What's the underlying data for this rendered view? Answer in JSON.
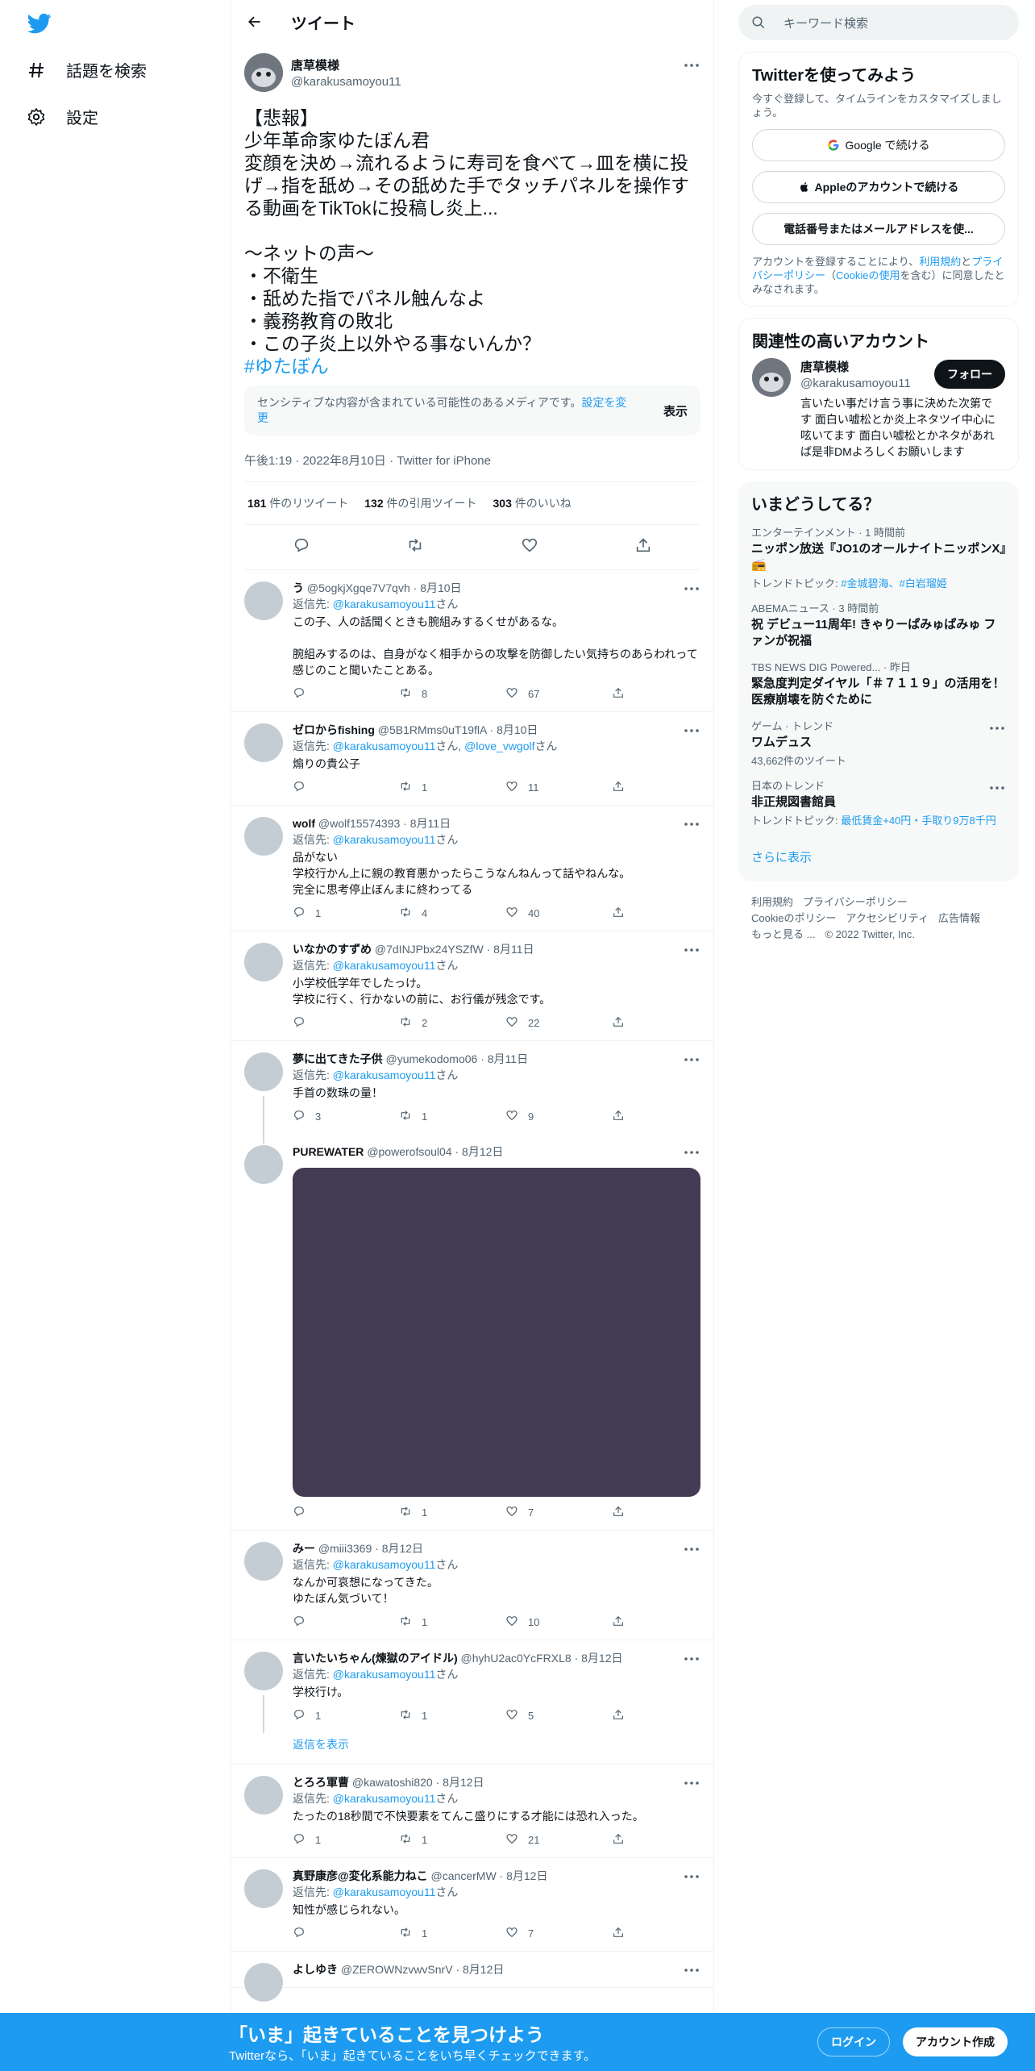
{
  "nav": {
    "explore_label": "話題を検索",
    "settings_label": "設定"
  },
  "header": {
    "title": "ツイート"
  },
  "main_tweet": {
    "name": "唐草模様",
    "handle": "@karakusamoyou11",
    "text": "【悲報】\n少年革命家ゆたぼん君\n変顔を決め→流れるように寿司を食べて→皿を横に投げ→指を舐め→その舐めた手でタッチパネルを操作する動画をTikTokに投稿し炎上...\n\n〜ネットの声〜\n・不衛生\n・舐めた指でパネル触んなよ\n・義務教育の敗北\n・この子炎上以外やる事ないんか？",
    "hashtag": "#ゆたぼん",
    "sensitive_msg": "センシティブな内容が含まれている可能性のあるメディアです。",
    "sensitive_link": "設定を変更",
    "sensitive_show": "表示",
    "meta": "午後1:19 · 2022年8月10日 · Twitter for iPhone",
    "retweets": "181",
    "retweets_label": "件のリツイート",
    "quotes": "132",
    "quotes_label": "件の引用ツイート",
    "likes": "303",
    "likes_label": "件のいいね"
  },
  "reply_prefix": "返信先: ",
  "san": "さん",
  "replies": [
    {
      "name": "う",
      "handle": "@5ogkjXgqe7V7qvh",
      "date": "8月10日",
      "to": "@karakusamoyou11",
      "text": "この子、人の話聞くときも腕組みするくせがあるな。\n\n腕組みするのは、自身がなく相手からの攻撃を防御したい気持ちのあらわれって感じのこと聞いたことある。",
      "replies": "",
      "retweets": "8",
      "likes": "67"
    },
    {
      "name": "ゼロからfishing",
      "handle": "@5B1RMms0uT19flA",
      "date": "8月10日",
      "to": "@karakusamoyou11",
      "to2": "@love_vwgolf",
      "text": "煽りの貴公子",
      "replies": "",
      "retweets": "1",
      "likes": "11"
    },
    {
      "name": "wolf",
      "handle": "@wolf15574393",
      "date": "8月11日",
      "to": "@karakusamoyou11",
      "text": "品がない\n学校行かん上に親の教育悪かったらこうなんねんって話やねんな。\n完全に思考停止ぼんまに終わってる",
      "replies": "1",
      "retweets": "4",
      "likes": "40"
    },
    {
      "name": "いなかのすずめ",
      "handle": "@7dINJPbx24YSZfW",
      "date": "8月11日",
      "to": "@karakusamoyou11",
      "text": "小学校低学年でしたっけ。\n学校に行く、行かないの前に、お行儀が残念です。",
      "replies": "",
      "retweets": "2",
      "likes": "22"
    },
    {
      "name": "夢に出てきた子供",
      "handle": "@yumekodomo06",
      "date": "8月11日",
      "to": "@karakusamoyou11",
      "text": "手首の数珠の量！",
      "replies": "3",
      "retweets": "1",
      "likes": "9"
    },
    {
      "name": "PUREWATER",
      "handle": "@powerofsoul04",
      "date": "8月12日",
      "replies": "",
      "retweets": "1",
      "likes": "7"
    },
    {
      "name": "みー",
      "handle": "@miii3369",
      "date": "8月12日",
      "to": "@karakusamoyou11",
      "text": "なんか可哀想になってきた。\nゆたぼん気づいて！",
      "replies": "",
      "retweets": "1",
      "likes": "10"
    },
    {
      "name": "言いたいちゃん(煉獄のアイドル)",
      "handle": "@hyhU2ac0YcFRXL8",
      "date": "8月12日",
      "to": "@karakusamoyou11",
      "text": "学校行け。",
      "replies": "1",
      "retweets": "1",
      "likes": "5"
    },
    {
      "name": "とろろ軍曹",
      "handle": "@kawatoshi820",
      "date": "8月12日",
      "to": "@karakusamoyou11",
      "text": "たったの18秒間で不快要素をてんこ盛りにする才能には恐れ入った。",
      "replies": "1",
      "retweets": "1",
      "likes": "21"
    },
    {
      "name": "真野康彦@変化系能力ねこ",
      "handle": "@cancerMW",
      "date": "8月12日",
      "to": "@karakusamoyou11",
      "text": "知性が感じられない。",
      "replies": "",
      "retweets": "1",
      "likes": "7"
    },
    {
      "name": "よしゆき",
      "handle": "@ZEROWNzvwvSnrV",
      "date": "8月12日"
    }
  ],
  "show_replies": "返信を表示",
  "right": {
    "search_placeholder": "キーワード検索",
    "signup_title": "Twitterを使ってみよう",
    "signup_sub": "今すぐ登録して、タイムラインをカスタマイズしましょう。",
    "google_btn": "Google で続ける",
    "apple_btn": "Appleのアカウントで続ける",
    "phone_btn": "電話番号またはメールアドレスを使...",
    "legal_a": "アカウントを登録することにより、",
    "legal_terms": "利用規約",
    "legal_b": "と",
    "legal_privacy": "プライバシーポリシー",
    "legal_c": "（",
    "legal_cookie": "Cookieの使用",
    "legal_d": "を含む）に同意したとみなされます。",
    "related_title": "関連性の高いアカウント",
    "related_name": "唐草模様",
    "related_handle": "@karakusamoyou11",
    "related_bio": "言いたい事だけ言う事に決めた次第です 面白い嘘松とか炎上ネタツイ中心に呟いてます 面白い嘘松とかネタがあれば是非DMよろしくお願いします",
    "follow_label": "フォロー",
    "trends_title": "いまどうしてる？",
    "trends": [
      {
        "ctx": "エンターテインメント · 1 時間前",
        "title": "ニッポン放送『JO1のオールナイトニッポンX』📻",
        "topic_prefix": "トレンドトピック: ",
        "topics": "#金城碧海、#白岩瑠姫"
      },
      {
        "ctx": "ABEMAニュース · 3 時間前",
        "title": "祝 デビュー11周年! きゃりーぱみゅぱみゅ ファンが祝福"
      },
      {
        "ctx": "TBS NEWS DIG Powered... · 昨日",
        "title": "緊急度判定ダイヤル「＃７１１９」の活用を！　医療崩壊を防ぐために"
      },
      {
        "ctx": "ゲーム · トレンド",
        "title": "ワムデュス",
        "count": "43,662件のツイート"
      },
      {
        "ctx": "日本のトレンド",
        "title": "非正規図書館員",
        "topic_prefix": "トレンドトピック: ",
        "topics": "最低賃金+40円・手取り9万8千円"
      }
    ],
    "show_more": "さらに表示",
    "footer1": [
      "利用規約",
      "プライバシーポリシー"
    ],
    "footer2": [
      "Cookieのポリシー",
      "アクセシビリティ",
      "広告情報"
    ],
    "footer3": [
      "もっと見る ...",
      "© 2022 Twitter, Inc."
    ]
  },
  "bottom": {
    "title": "「いま」起きていることを見つけよう",
    "sub": "Twitterなら、「いま」起きていることをいち早くチェックできます。",
    "login": "ログイン",
    "signup": "アカウント作成"
  },
  "colors": {
    "accent": "#1d9bf0",
    "text": "#0f1419",
    "muted": "#536471"
  }
}
